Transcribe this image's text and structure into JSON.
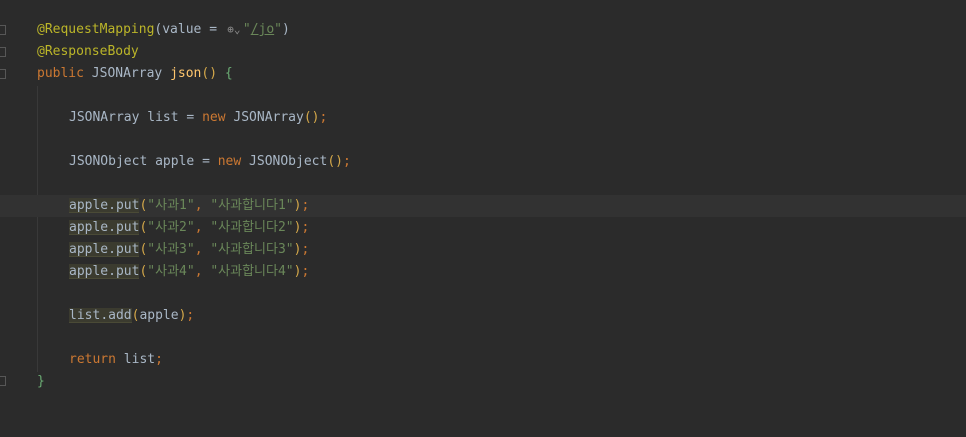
{
  "editor": {
    "language": "java",
    "annotation_request_mapping": "@RequestMapping",
    "value_param": "value",
    "url_icon": "globe-dropdown-icon",
    "mapping_path": "/jo",
    "annotation_response_body": "@ResponseBody",
    "kw_public": "public",
    "return_type": "JSONArray",
    "method_name": "json",
    "var_list": "list",
    "kw_new": "new",
    "type_jsonarray": "JSONArray",
    "type_jsonobject": "JSONObject",
    "var_apple": "apple",
    "put_method": "put",
    "puts": [
      {
        "key": "\"사과1\"",
        "value": "\"사과합니다1\""
      },
      {
        "key": "\"사과2\"",
        "value": "\"사과합니다2\""
      },
      {
        "key": "\"사과3\"",
        "value": "\"사과합니다3\""
      },
      {
        "key": "\"사과4\"",
        "value": "\"사과합니다4\""
      }
    ],
    "add_method": "add",
    "kw_return": "return",
    "colors": {
      "background": "#2b2b2b",
      "annotation": "#bbb529",
      "keyword": "#cc7832",
      "plain": "#a9b7c6",
      "method": "#ffc66d",
      "string": "#6a8759"
    }
  }
}
